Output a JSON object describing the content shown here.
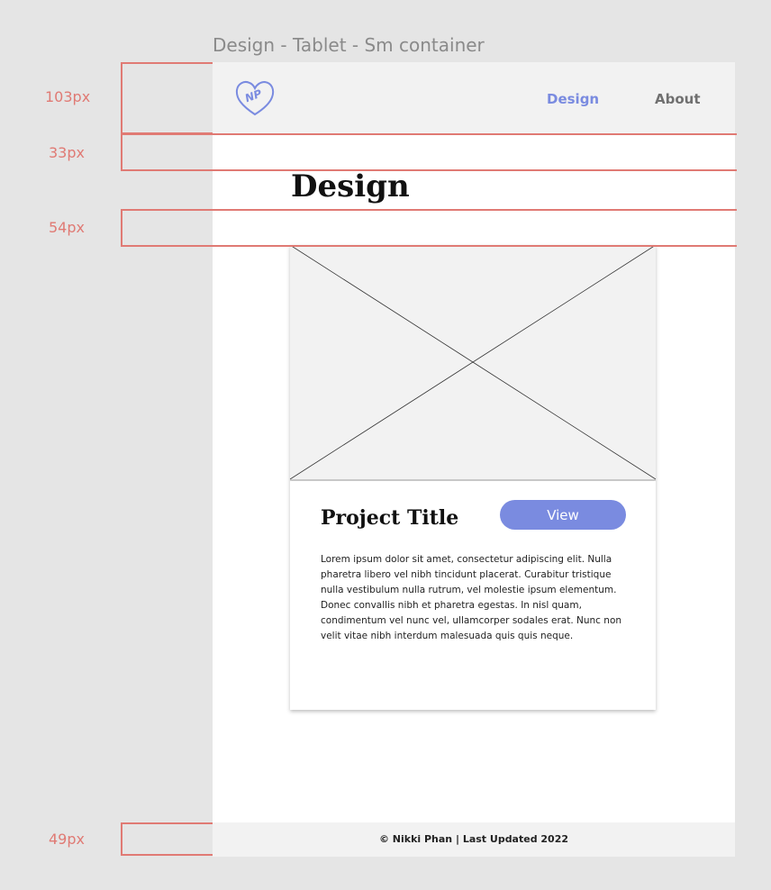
{
  "frame_label": "Design - Tablet - Sm container",
  "nav": {
    "logo_text": "NP",
    "links": [
      "Design",
      "About"
    ]
  },
  "page": {
    "title": "Design"
  },
  "card": {
    "title": "Project Title",
    "button_label": "View",
    "body": "Lorem ipsum dolor sit amet, consectetur adipiscing elit. Nulla pharetra libero vel nibh tincidunt placerat. Curabitur tristique nulla vestibulum nulla rutrum, vel molestie ipsum elementum. Donec convallis nibh et pharetra egestas. In nisl quam, condimentum vel nunc vel, ullamcorper sodales erat. Nunc non velit vitae nibh interdum malesuada quis quis neque."
  },
  "footer": {
    "text": "© Nikki Phan | Last Updated 2022"
  },
  "annotations": [
    "103px",
    "33px",
    "54px",
    "49px"
  ],
  "colors": {
    "accent": "#7a8be0",
    "annotation": "#e07a74",
    "nav_background": "#f2f2f2"
  }
}
